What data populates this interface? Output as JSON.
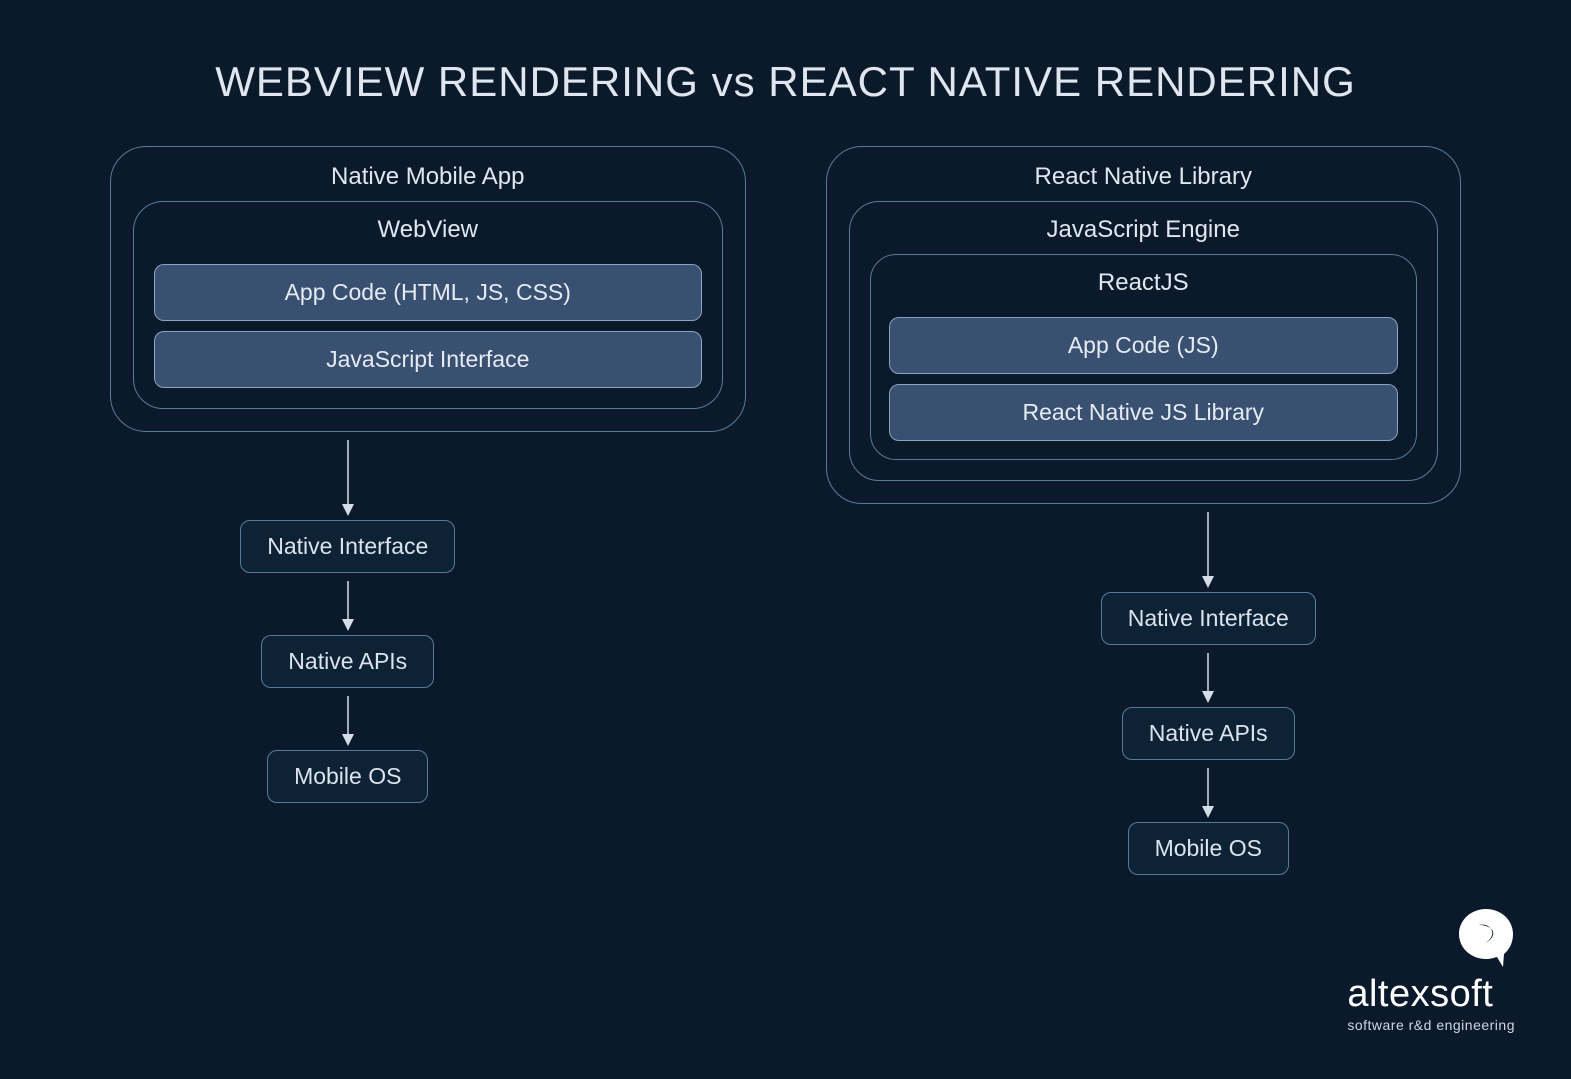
{
  "title": "WEBVIEW RENDERING vs REACT NATIVE RENDERING",
  "left": {
    "outer": "Native Mobile App",
    "mid": "WebView",
    "block1": "App Code (HTML, JS, CSS)",
    "block2": "JavaScript Interface",
    "flow1": "Native Interface",
    "flow2": "Native APIs",
    "flow3": "Mobile OS"
  },
  "right": {
    "outer": "React Native Library",
    "mid": "JavaScript Engine",
    "inner": "ReactJS",
    "block1": "App Code (JS)",
    "block2": "React Native JS Library",
    "flow1": "Native Interface",
    "flow2": "Native APIs",
    "flow3": "Mobile OS"
  },
  "logo": {
    "name": "altexsoft",
    "tagline": "software r&d engineering"
  }
}
